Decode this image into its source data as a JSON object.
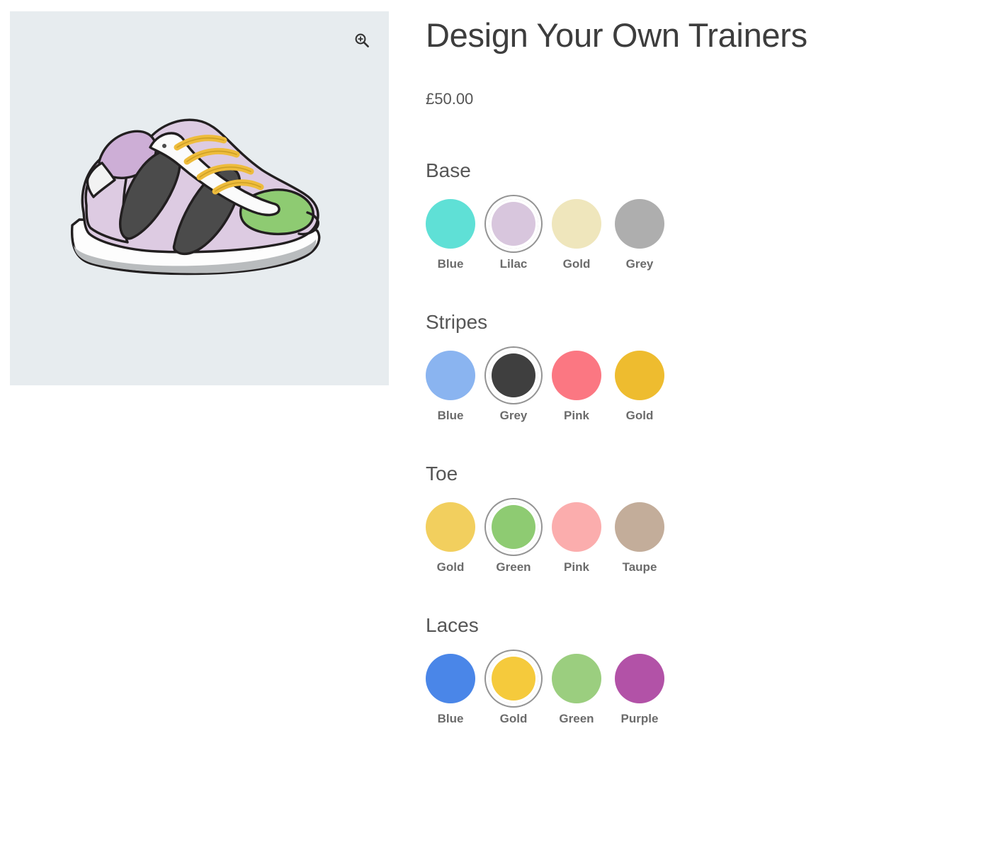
{
  "product": {
    "title": "Design Your Own Trainers",
    "price": "£50.00"
  },
  "image_panel": {
    "zoom_icon": "magnifier-plus-icon",
    "background_color": "#e7ecef",
    "illustration": "trainer-sneaker-illustration"
  },
  "options": [
    {
      "heading": "Base",
      "selected": "Lilac",
      "swatches": [
        {
          "label": "Blue",
          "color": "#5fe0d6"
        },
        {
          "label": "Lilac",
          "color": "#d8c6dd"
        },
        {
          "label": "Gold",
          "color": "#efe6bc"
        },
        {
          "label": "Grey",
          "color": "#aeaeae"
        }
      ]
    },
    {
      "heading": "Stripes",
      "selected": "Grey",
      "swatches": [
        {
          "label": "Blue",
          "color": "#8ab4f0"
        },
        {
          "label": "Grey",
          "color": "#3f3f3f"
        },
        {
          "label": "Pink",
          "color": "#fb7782"
        },
        {
          "label": "Gold",
          "color": "#eebc2f"
        }
      ]
    },
    {
      "heading": "Toe",
      "selected": "Green",
      "swatches": [
        {
          "label": "Gold",
          "color": "#f2cf5e"
        },
        {
          "label": "Green",
          "color": "#8ecb72"
        },
        {
          "label": "Pink",
          "color": "#fbadad"
        },
        {
          "label": "Taupe",
          "color": "#c3ad9a"
        }
      ]
    },
    {
      "heading": "Laces",
      "selected": "Gold",
      "swatches": [
        {
          "label": "Blue",
          "color": "#4a86e8"
        },
        {
          "label": "Gold",
          "color": "#f5ca3c"
        },
        {
          "label": "Green",
          "color": "#9bce7f"
        },
        {
          "label": "Purple",
          "color": "#b252a7"
        }
      ]
    }
  ],
  "preview_colors": {
    "base": "#ddcbe2",
    "stripes": "#4b4b4b",
    "toe": "#8ecb72",
    "laces": "#eebc3c",
    "sole": "#fdfdfd",
    "outline": "#221f20"
  }
}
